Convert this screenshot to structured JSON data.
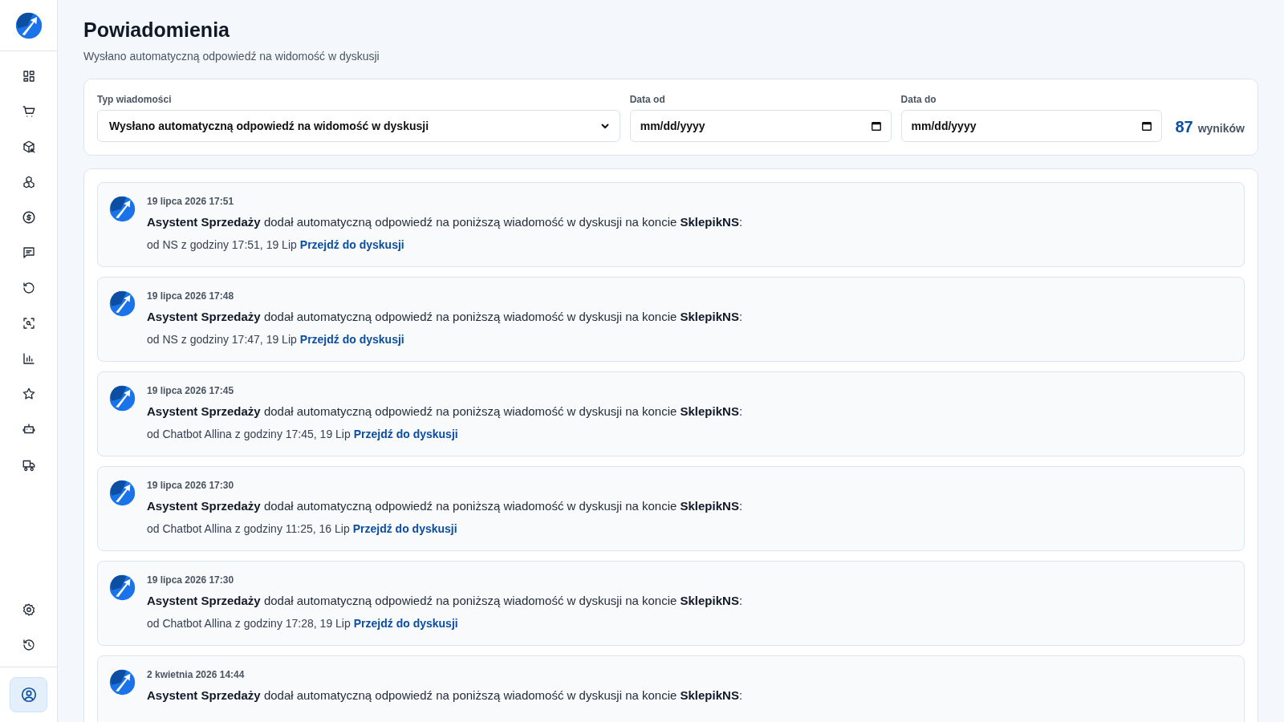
{
  "page": {
    "title": "Powiadomienia",
    "subtitle": "Wysłano automatyczną odpowiedź na widomość w dyskusji"
  },
  "account_button": {
    "selected": true
  },
  "filters": {
    "type": {
      "label": "Typ wiadomości",
      "value": "Wysłano automatyczną odpowiedź na widomość w dyskusji"
    },
    "date_from": {
      "label": "Data od",
      "placeholder": "mm/dd/yyyy"
    },
    "date_to": {
      "label": "Data do",
      "placeholder": "mm/dd/yyyy"
    },
    "count": "87",
    "count_label": "wyników"
  },
  "notifications": [
    {
      "date": "19 lipca 2026 17:51",
      "message": "**Asystent Sprzedaży** dodał automatyczną odpowiedź na poniższą wiadomość w dyskusji na koncie **SklepikNS**:",
      "details": "od NS z godziny 17:51, 19 Lip",
      "link": "Przejdź do dyskusji"
    },
    {
      "date": "19 lipca 2026 17:48",
      "message": "**Asystent Sprzedaży** dodał automatyczną odpowiedź na poniższą wiadomość w dyskusji na koncie **SklepikNS**:",
      "details": "od NS z godziny 17:47, 19 Lip",
      "link": "Przejdź do dyskusji"
    },
    {
      "date": "19 lipca 2026 17:45",
      "message": "**Asystent Sprzedaży** dodał automatyczną odpowiedź na poniższą wiadomość w dyskusji na koncie **SklepikNS**:",
      "details": "od Chatbot Allina z godziny 17:45, 19 Lip",
      "link": "Przejdź do dyskusji"
    },
    {
      "date": "19 lipca 2026 17:30",
      "message": "**Asystent Sprzedaży** dodał automatyczną odpowiedź na poniższą wiadomość w dyskusji na koncie **SklepikNS**:",
      "details": "od Chatbot Allina z godziny 11:25, 16 Lip",
      "link": "Przejdź do dyskusji"
    },
    {
      "date": "19 lipca 2026 17:30",
      "message": "**Asystent Sprzedaży** dodał automatyczną odpowiedź na poniższą wiadomość w dyskusji na koncie **SklepikNS**:",
      "details": "od Chatbot Allina z godziny 17:28, 19 Lip",
      "link": "Przejdź do dyskusji"
    },
    {
      "date": "2 kwietnia 2026 14:44",
      "message": "**Asystent Sprzedaży** dodał automatyczną odpowiedź na poniższą wiadomość w dyskusji na koncie **SklepikNS**:"
    }
  ]
}
